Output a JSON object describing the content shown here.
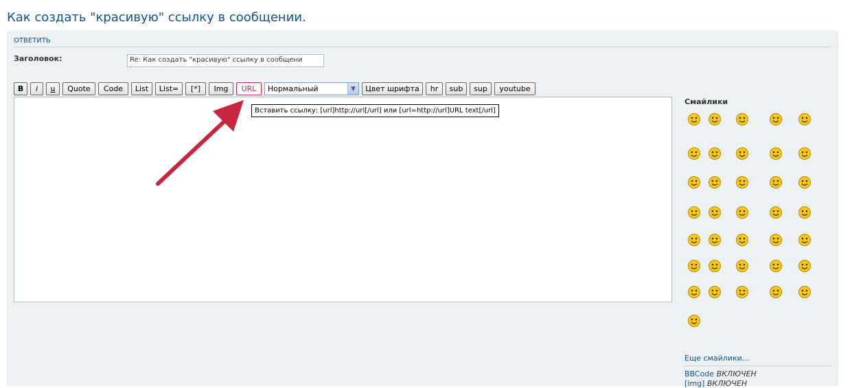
{
  "page": {
    "title": "Как создать \"красивую\" ссылку в сообщении."
  },
  "form": {
    "post_title": "Ответить",
    "subject_label": "Заголовок:",
    "subject_value": "Re: Как создать \"красивую\" ссылку в сообщени"
  },
  "toolbar": {
    "bold": "B",
    "italic": "i",
    "underline": "u",
    "quote": "Quote",
    "code": "Code",
    "list": "List",
    "list_ordered": "List=",
    "list_item": "[*]",
    "img": "Img",
    "url": "URL",
    "font_size": "Нормальный",
    "font_color": "Цвет шрифта",
    "hr": "hr",
    "sub": "sub",
    "sup": "sup",
    "youtube": "youtube"
  },
  "tooltip": {
    "text": "Вставить ссылку: [url]http://url[/url] или [url=http://url]URL text[/url]"
  },
  "annotation": {
    "arrow_color": "#c8253f"
  },
  "sidebar": {
    "smilies_title": "Смайлики",
    "smiley_count": 36,
    "more_smilies": "Еще смайлики...",
    "bbcode_label": "BBCode",
    "bbcode_state": "ВКЛЮЧЕН",
    "img_label": "[img]",
    "img_state": "ВКЛЮЧЕН"
  },
  "colors": {
    "link": "#105289",
    "panel_bg": "#ECF1F3",
    "active_button": "#bc2a4d",
    "smiley_yellow": "#f6c81a"
  }
}
